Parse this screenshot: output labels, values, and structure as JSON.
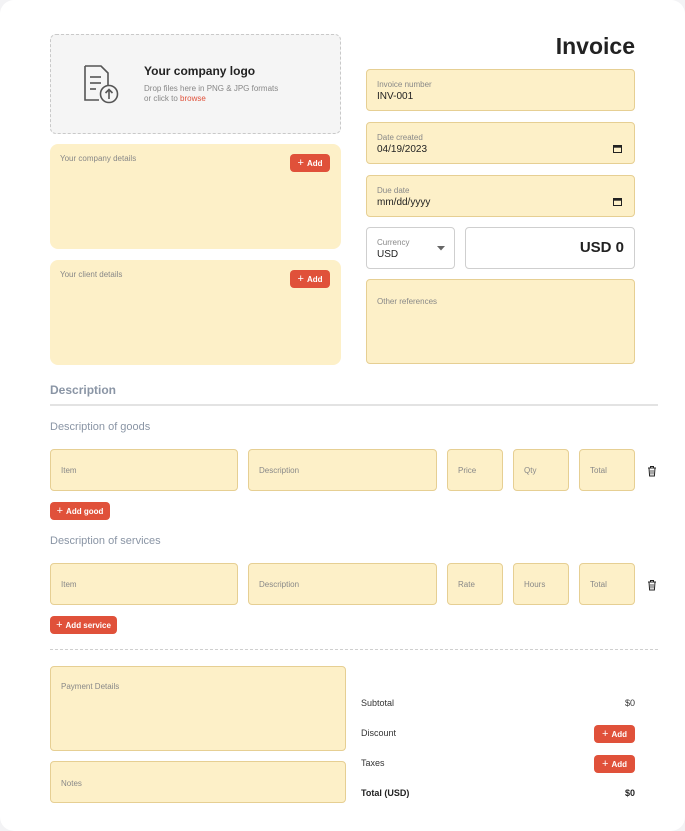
{
  "title": "Invoice",
  "logo": {
    "heading": "Your company logo",
    "hint_line1": "Drop files here in PNG & JPG formats",
    "hint_line2_prefix": "or click to ",
    "browse_link": "browse"
  },
  "company_details": {
    "label": "Your company details",
    "add": "Add"
  },
  "client_details": {
    "label": "Your client details",
    "add": "Add"
  },
  "invoice_number": {
    "label": "Invoice number",
    "value": "INV-001"
  },
  "date_created": {
    "label": "Date created",
    "value": "04/19/2023"
  },
  "due_date": {
    "label": "Due date",
    "value": "mm/dd/yyyy"
  },
  "currency": {
    "label": "Currency",
    "value": "USD"
  },
  "amount_display": "USD 0",
  "other_references": {
    "label": "Other references"
  },
  "description_heading": "Description",
  "goods": {
    "heading": "Description of goods",
    "columns": [
      "Item",
      "Description",
      "Price",
      "Qty",
      "Total"
    ],
    "add_button": "Add good"
  },
  "services": {
    "heading": "Description of services",
    "columns": [
      "Item",
      "Description",
      "Rate",
      "Hours",
      "Total"
    ],
    "add_button": "Add service"
  },
  "payment_details": {
    "label": "Payment Details"
  },
  "notes": {
    "label": "Notes"
  },
  "summary": {
    "subtotal_label": "Subtotal",
    "subtotal_value": "$0",
    "discount_label": "Discount",
    "discount_add": "Add",
    "taxes_label": "Taxes",
    "taxes_add": "Add",
    "total_label": "Total (USD)",
    "total_value": "$0"
  },
  "colors": {
    "accent": "#e0513a",
    "field_bg": "#fdf0c8",
    "field_border": "#e6cf93"
  }
}
